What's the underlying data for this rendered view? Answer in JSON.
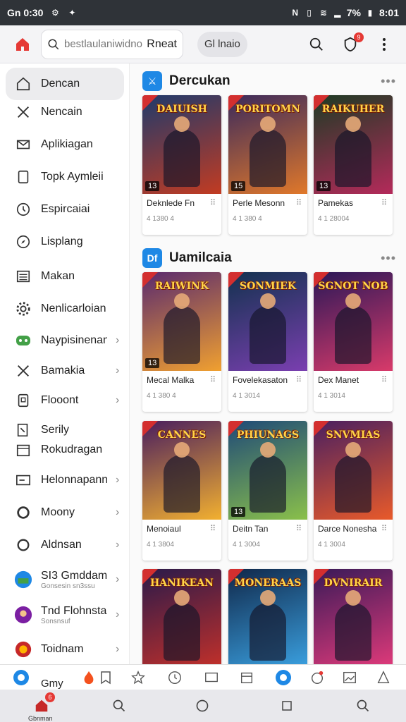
{
  "status_bar": {
    "time": "Gn 0:30",
    "battery": "7%",
    "clock": "8:01"
  },
  "top_bar": {
    "search_placeholder": "bestlaulaniwidno",
    "search_action": "Rneat",
    "tab_pill": "Gl lnaio",
    "notification_badge": "9"
  },
  "sidebar": {
    "items": [
      {
        "label": "Dencan",
        "icon": "home-icon"
      },
      {
        "label": "Nencain",
        "icon": "tools-icon"
      },
      {
        "label": "Aplikiagan",
        "icon": "envelope-icon"
      },
      {
        "label": "Topk Aymleii",
        "icon": "page-icon"
      },
      {
        "label": "Espircaiai",
        "icon": "clock-icon"
      },
      {
        "label": "Lisplang",
        "icon": "compass-icon"
      },
      {
        "label": "Makan",
        "icon": "list-icon"
      },
      {
        "label": "Nenlicarloian",
        "icon": "gear-icon"
      },
      {
        "label": "Naypisinenan",
        "icon": "gamepad-icon"
      },
      {
        "label": "Bamakia",
        "icon": "tools-icon"
      },
      {
        "label": "Flooont",
        "icon": "bookmark-icon"
      },
      {
        "label": "Serily",
        "icon": "edit-icon"
      },
      {
        "label": "Rokudragan",
        "icon": "calendar-icon"
      },
      {
        "label": "Helonnapann",
        "icon": "card-icon"
      },
      {
        "label": "Moony",
        "icon": "ring-icon"
      },
      {
        "label": "Aldnsan",
        "icon": "ring-icon"
      },
      {
        "label": "SI3 Gmddam",
        "sub": "Gonsesin sn3ssu",
        "icon": "app-logo-icon"
      },
      {
        "label": "Tnd Flohnstann",
        "sub": "Sonsnsuf",
        "icon": "app-logo-icon"
      },
      {
        "label": "Toidnam",
        "icon": "app-logo-icon"
      }
    ]
  },
  "sections": [
    {
      "title": "Dercukan",
      "more": "•••",
      "cards": [
        {
          "art": "DAIUISH",
          "rating": "13",
          "name": "Deknlede Fn",
          "meta": "4 1380 4",
          "colors": [
            "#1f3a6b",
            "#c23b22"
          ]
        },
        {
          "art": "PORITOMN",
          "rating": "15",
          "name": "Perle Mesonn",
          "meta": "4 1 380 4",
          "colors": [
            "#3b2a5c",
            "#e0782a"
          ]
        },
        {
          "art": "RAIKUHER",
          "rating": "13",
          "name": "Pamekas",
          "meta": "4 1 28004",
          "colors": [
            "#1d3b24",
            "#b42a5a"
          ]
        }
      ]
    },
    {
      "title": "Uamilcaia",
      "more": "•••",
      "cards": [
        {
          "art": "RAIWINK",
          "rating": "13",
          "name": "Mecal Malka",
          "meta": "4 1 380 4",
          "colors": [
            "#5a2a6e",
            "#f0a030"
          ]
        },
        {
          "art": "SONMIEK",
          "rating": "",
          "name": "Fovelekasaton",
          "meta": "4 1 3014",
          "colors": [
            "#13324f",
            "#7a3fb0"
          ]
        },
        {
          "art": "SGNOT NOB",
          "rating": "",
          "name": "Dex Manet",
          "meta": "4 1 3014",
          "colors": [
            "#2a1858",
            "#d83a6a"
          ]
        }
      ]
    },
    {
      "title": "",
      "more": "",
      "cards": [
        {
          "art": "CANNES",
          "rating": "",
          "name": "Menoiaul",
          "meta": "4 1 3804",
          "colors": [
            "#4a1e5e",
            "#f2b030"
          ]
        },
        {
          "art": "PHIUNAGS",
          "rating": "13",
          "name": "Deitn Tan",
          "meta": "4 1 3004",
          "colors": [
            "#1f4a78",
            "#8ac04a"
          ]
        },
        {
          "art": "SNVMIAS",
          "rating": "",
          "name": "Darce Nonesha",
          "meta": "4 1 3004",
          "colors": [
            "#4a2060",
            "#e85a2a"
          ]
        }
      ]
    },
    {
      "title": "",
      "more": "",
      "cards": [
        {
          "art": "HANIKEAN",
          "rating": "",
          "name": "",
          "meta": "",
          "colors": [
            "#2a1a4a",
            "#c2302a"
          ]
        },
        {
          "art": "MONERAAS",
          "rating": "",
          "name": "",
          "meta": "",
          "colors": [
            "#10284a",
            "#3aa0e0"
          ]
        },
        {
          "art": "DVNIRAIR",
          "rating": "",
          "name": "",
          "meta": "",
          "colors": [
            "#3a1a58",
            "#e03a7a"
          ]
        }
      ]
    }
  ],
  "app_strip": {
    "label": "Gmy"
  },
  "nav_bar": {
    "home_label": "Gbnman",
    "home_badge": "6"
  },
  "colors": {
    "accent": "#e53935",
    "primary": "#1a73e8"
  }
}
